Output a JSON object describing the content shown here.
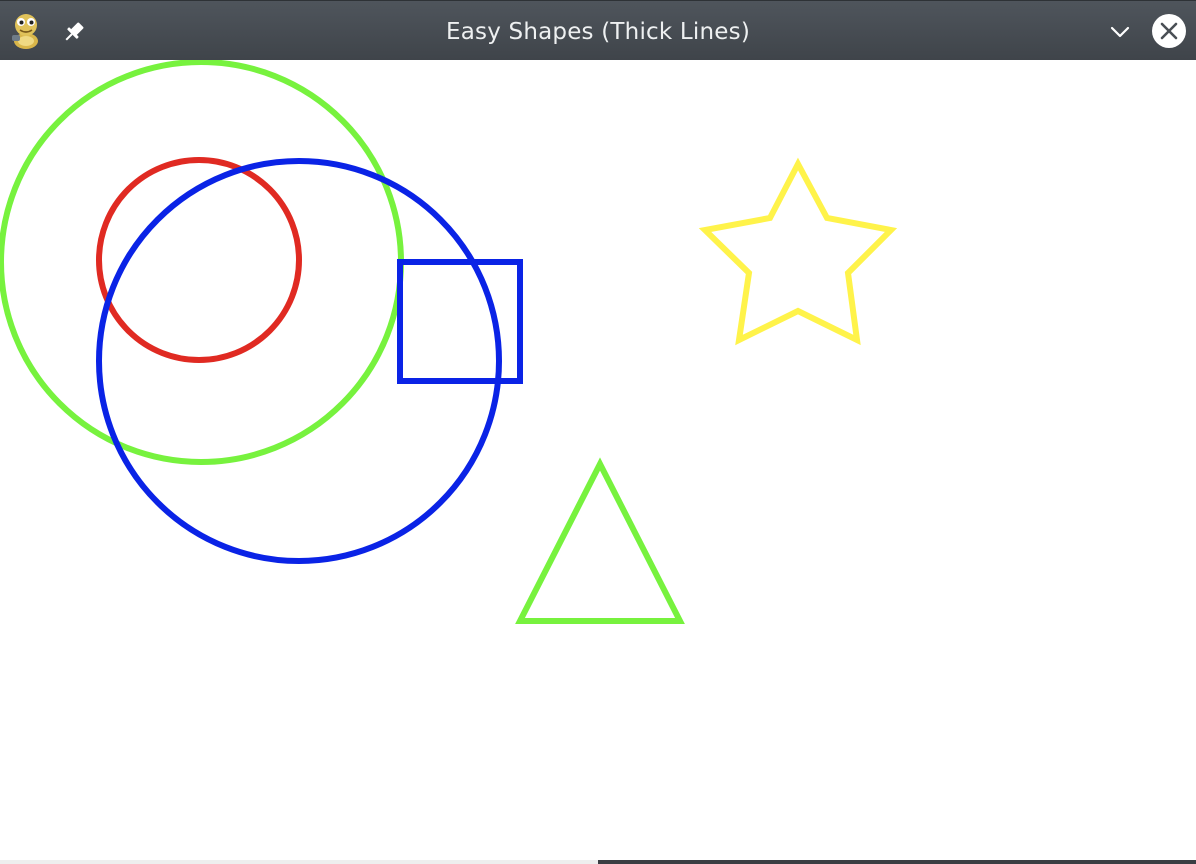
{
  "window": {
    "title": "Easy Shapes (Thick Lines)",
    "app_icon": "python-snake-icon",
    "pin_icon": "pin-icon",
    "minimize_icon": "chevron-down-icon",
    "close_icon": "close-icon"
  },
  "colors": {
    "titlebar": "#474c52",
    "title_text": "#eef0f1",
    "canvas_background": "#ffffff",
    "green": "#77f23e",
    "red": "#e02a22",
    "blue": "#0a23e6",
    "yellow": "#fff34a"
  },
  "shapes": [
    {
      "kind": "circle",
      "color": "green"
    },
    {
      "kind": "circle",
      "color": "red"
    },
    {
      "kind": "circle",
      "color": "blue"
    },
    {
      "kind": "rectangle",
      "color": "blue"
    },
    {
      "kind": "star",
      "color": "yellow"
    },
    {
      "kind": "triangle",
      "color": "green"
    }
  ]
}
